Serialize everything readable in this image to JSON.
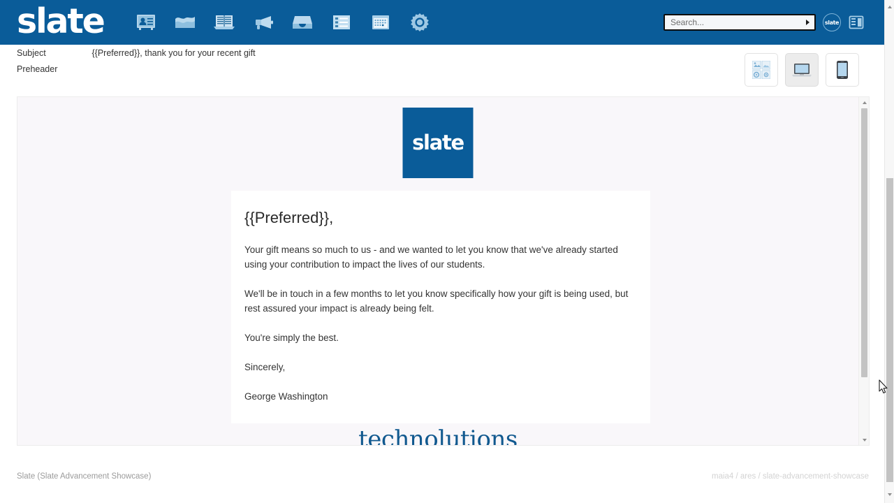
{
  "topbar": {
    "brand": "slate",
    "background_color": "#0a5c99",
    "nav_icons": [
      {
        "name": "contact-card-icon",
        "label": "Records"
      },
      {
        "name": "chart-icon",
        "label": "Reports"
      },
      {
        "name": "book-icon",
        "label": "Reader"
      },
      {
        "name": "megaphone-icon",
        "label": "Deliver"
      },
      {
        "name": "inbox-tray-icon",
        "label": "Inbox"
      },
      {
        "name": "list-icon",
        "label": "Queries"
      },
      {
        "name": "calendar-icon",
        "label": "Calendar"
      },
      {
        "name": "gear-icon",
        "label": "Database"
      }
    ],
    "search": {
      "value": "",
      "placeholder": "Search..."
    },
    "slate_badge_label": "slate",
    "panel_icon_name": "panel-layout-icon"
  },
  "meta": {
    "subject_label": "Subject",
    "subject_value": "{{Preferred}}, thank you for your recent gift",
    "preheader_label": "Preheader",
    "preheader_value": ""
  },
  "view_toggles": {
    "items": [
      {
        "name": "images-view-button",
        "icon": "image-grid-icon",
        "label": "Images",
        "active": false
      },
      {
        "name": "desktop-view-button",
        "icon": "laptop-icon",
        "label": "Desktop",
        "active": true
      },
      {
        "name": "mobile-view-button",
        "icon": "mobile-phone-icon",
        "label": "Mobile",
        "active": false
      }
    ]
  },
  "email": {
    "logo_text": "slate",
    "logo_color": "#0a5c99",
    "greeting": "{{Preferred}},",
    "paragraphs": [
      "Your gift means so much to us - and we wanted to let you know that we've already started using your contribution to impact the lives of our students.",
      "We'll be in touch in a few months to let you know specifically how your gift is being used, but rest assured your impact is already being felt.",
      "You're simply the best.",
      "Sincerely,",
      "George Washington"
    ],
    "footer_brand": "technolutions"
  },
  "footer": {
    "left": "Slate (Slate Advancement Showcase)",
    "right": "maia4 / ares / slate-advancement-showcase"
  }
}
